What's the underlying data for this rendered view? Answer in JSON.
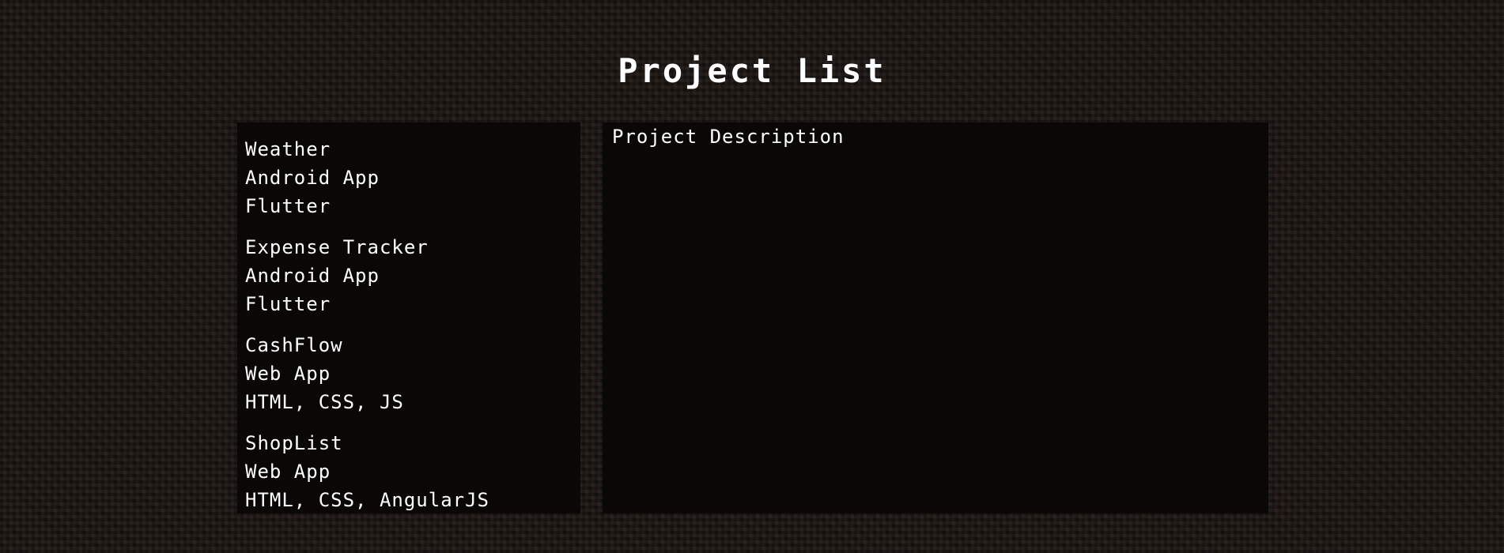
{
  "page": {
    "title": "Project List"
  },
  "projects": [
    {
      "name": "Weather",
      "type": "Android App",
      "tech": "Flutter"
    },
    {
      "name": "Expense Tracker",
      "type": "Android App",
      "tech": "Flutter"
    },
    {
      "name": "CashFlow",
      "type": "Web App",
      "tech": "HTML, CSS, JS"
    },
    {
      "name": "ShopList",
      "type": "Web App",
      "tech": "HTML, CSS, AngularJS"
    }
  ],
  "description": {
    "title": "Project Description"
  },
  "colors": {
    "background": "#1f1915",
    "panel": "#0a0807",
    "text": "#ffffff"
  }
}
